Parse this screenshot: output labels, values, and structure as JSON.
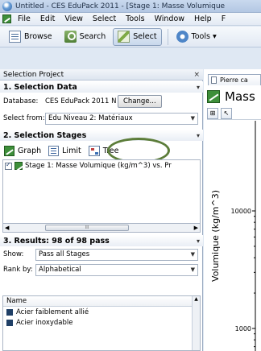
{
  "window": {
    "title": "Untitled - CES EduPack 2011 - [Stage 1: Masse Volumique"
  },
  "menu": {
    "items": [
      "File",
      "Edit",
      "View",
      "Select",
      "Tools",
      "Window",
      "Help",
      "F"
    ]
  },
  "toolbar": {
    "browse_label": "Browse",
    "search_label": "Search",
    "select_label": "Select",
    "tools_label": "Tools ▾"
  },
  "left_panel": {
    "title": "Selection Project",
    "close": "×",
    "selection_data": {
      "heading": "1. Selection Data",
      "database_label": "Database:",
      "database_value": "CES EduPack 2011 N",
      "change_button": "Change...",
      "select_from_label": "Select from:",
      "select_from_value": "Edu Niveau 2: Matériaux"
    },
    "selection_stages": {
      "heading": "2. Selection Stages",
      "graph_label": "Graph",
      "limit_label": "Limit",
      "tree_label": "Tree",
      "stages": [
        {
          "label": "Stage 1: Masse Volumique (kg/m^3) vs. Pr",
          "checked": true
        }
      ],
      "scroll_thumb": "III"
    },
    "results": {
      "heading": "3. Results: 98 of 98 pass",
      "show_label": "Show:",
      "show_value": "Pass all Stages",
      "rank_label": "Rank by:",
      "rank_value": "Alphabetical",
      "column_name": "Name",
      "rows": [
        "Acier faiblement allié",
        "Acier inoxydable"
      ]
    }
  },
  "right_panel": {
    "tab_label": "Pierre ca",
    "title": "Mass",
    "y_axis_label": "Volumique (kg/m^3)"
  },
  "chart_data": {
    "type": "scatter",
    "ylabel": "Volumique (kg/m^3)",
    "yscale": "log",
    "y_ticks": [
      10000,
      1000
    ],
    "y_tick_labels": [
      "10000",
      "1000"
    ]
  },
  "colors": {
    "highlight_ellipse": "#5c7d3a",
    "window_bg": "#dfe8f3"
  }
}
